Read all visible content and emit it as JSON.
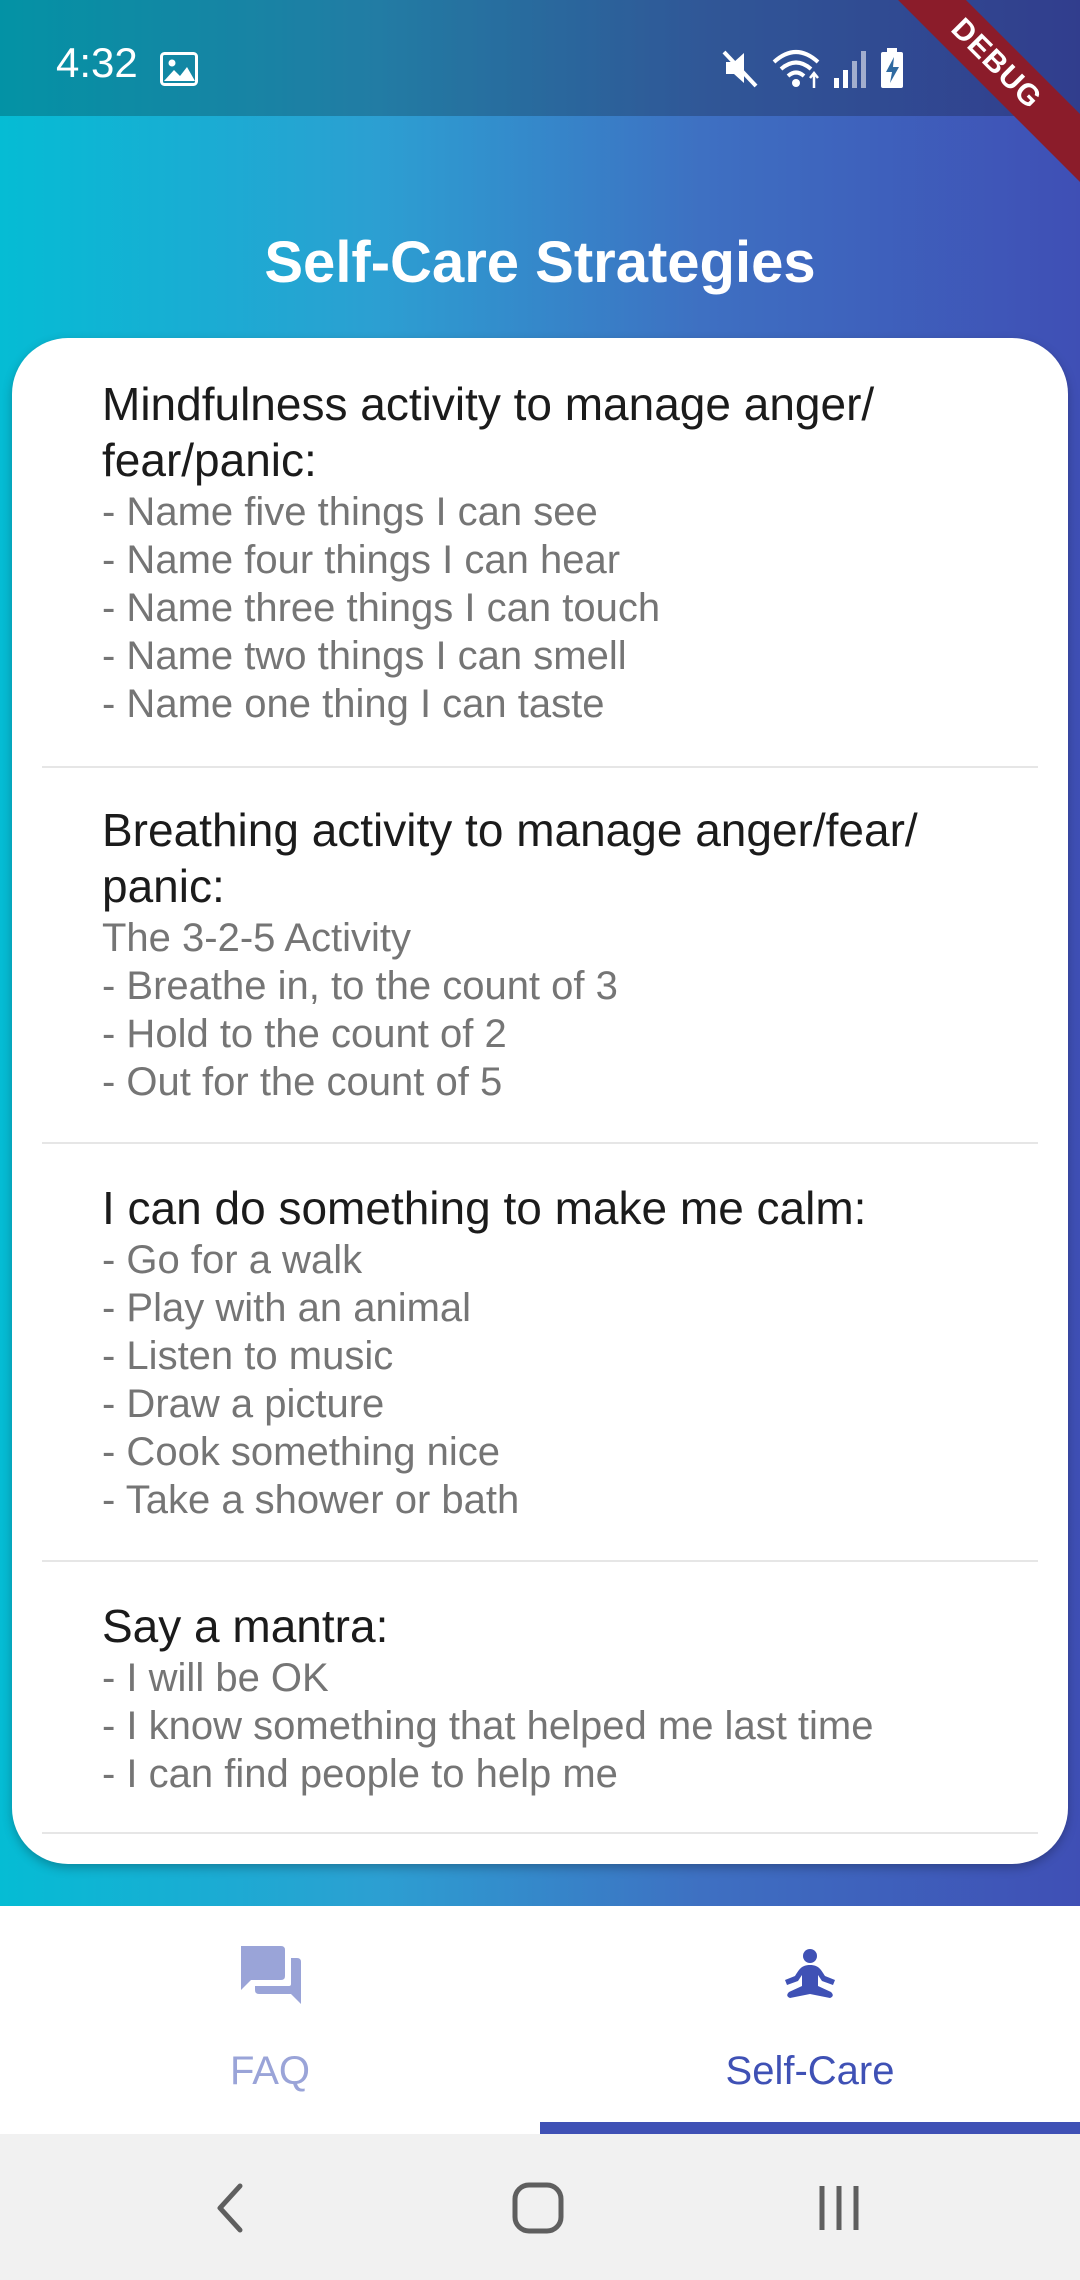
{
  "status_bar": {
    "time": "4:32",
    "icons": [
      "gallery-icon",
      "mute-icon",
      "wifi-icon",
      "signal-icon",
      "battery-charging-icon"
    ]
  },
  "debug_banner": "DEBUG",
  "app": {
    "title": "Self-Care Strategies"
  },
  "sections": [
    {
      "title": "Mindfulness activity to manage anger/ fear/panic:",
      "lines": [
        "- Name five things I can see",
        "- Name four things I can hear",
        "- Name three things I can touch",
        "- Name two things I can smell",
        "- Name one thing I can taste"
      ]
    },
    {
      "title": "Breathing activity to manage anger/fear/ panic:",
      "lines": [
        "The 3-2-5 Activity",
        "- Breathe in, to the count of 3",
        "- Hold to the count of 2",
        "- Out for the count of 5"
      ]
    },
    {
      "title": "I can do something to make me calm:",
      "lines": [
        "- Go for a walk",
        "- Play with an animal",
        "- Listen to music",
        "- Draw a picture",
        "- Cook something nice",
        "- Take a shower or bath"
      ]
    },
    {
      "title": "Say a mantra:",
      "lines": [
        "- I will be OK",
        "- I know something that helped me last time",
        "- I can find people to help me"
      ]
    }
  ],
  "bottom_nav": {
    "tabs": [
      {
        "label": "FAQ",
        "icon": "forum-icon",
        "selected": false
      },
      {
        "label": "Self-Care",
        "icon": "meditation-icon",
        "selected": true
      }
    ]
  },
  "system_nav": {
    "buttons": [
      "back-icon",
      "home-icon",
      "recents-icon"
    ]
  },
  "colors": {
    "primary": "#3f51b5",
    "gradient_start": "#05bcd4",
    "gradient_end": "#3f4fb5",
    "inactive_tab": "#9aa4d8",
    "debug": "#8b1c2a"
  }
}
